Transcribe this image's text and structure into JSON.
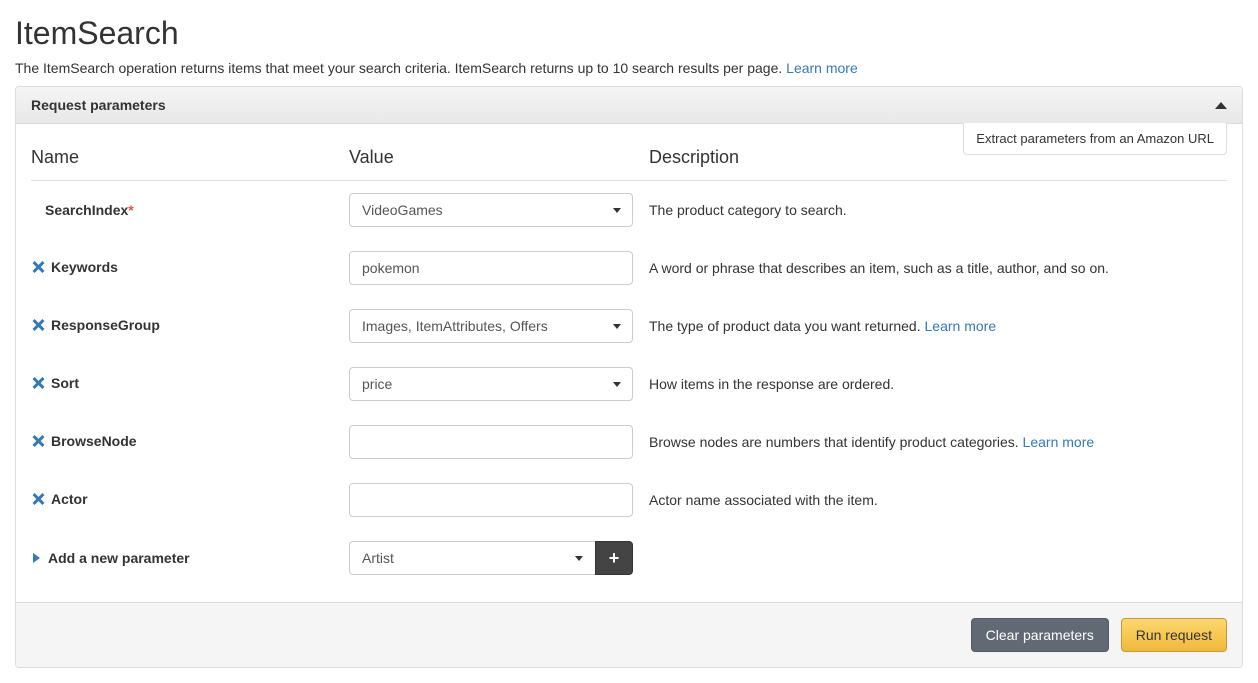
{
  "title": "ItemSearch",
  "subtitle_text": "The ItemSearch operation returns items that meet your search criteria. ItemSearch returns up to 10 search results per page. ",
  "subtitle_link": "Learn more",
  "panel_title": "Request parameters",
  "extract_label": "Extract parameters from an Amazon URL",
  "headers": {
    "name": "Name",
    "value": "Value",
    "description": "Description"
  },
  "rows": [
    {
      "name": "SearchIndex",
      "required": true,
      "removable": false,
      "type": "select",
      "value": "VideoGames",
      "desc": "The product category to search."
    },
    {
      "name": "Keywords",
      "required": false,
      "removable": true,
      "type": "text",
      "value": "pokemon",
      "desc": "A word or phrase that describes an item, such as a title, author, and so on."
    },
    {
      "name": "ResponseGroup",
      "required": false,
      "removable": true,
      "type": "select",
      "value": "Images, ItemAttributes, Offers",
      "desc": "The type of product data you want returned. ",
      "link": "Learn more"
    },
    {
      "name": "Sort",
      "required": false,
      "removable": true,
      "type": "select",
      "value": "price",
      "desc": "How items in the response are ordered."
    },
    {
      "name": "BrowseNode",
      "required": false,
      "removable": true,
      "type": "text",
      "value": "",
      "desc": "Browse nodes are numbers that identify product categories. ",
      "link": "Learn more"
    },
    {
      "name": "Actor",
      "required": false,
      "removable": true,
      "type": "text",
      "value": "",
      "desc": "Actor name associated with the item."
    }
  ],
  "add_param_label": "Add a new parameter",
  "add_param_value": "Artist",
  "footer": {
    "clear": "Clear parameters",
    "run": "Run request"
  }
}
